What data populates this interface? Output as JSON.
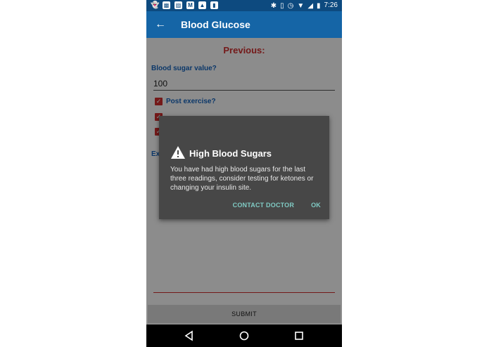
{
  "status_bar": {
    "time": "7:26",
    "left_icons": [
      "ghost-icon",
      "ticket-icon",
      "bag-icon",
      "gmail-icon",
      "image-icon",
      "sim-icon"
    ],
    "right_icons": [
      "bluetooth-icon",
      "vibrate-icon",
      "alarm-icon",
      "wifi-icon",
      "signal-icon",
      "battery-icon"
    ]
  },
  "app_bar": {
    "title": "Blood Glucose"
  },
  "form": {
    "heading": "Previous:",
    "value_label": "Blood sugar value?",
    "value": "100",
    "checkboxes": [
      {
        "label": "Post exercise?",
        "checked": true
      },
      {
        "label": "",
        "checked": true
      },
      {
        "label": "",
        "checked": true
      }
    ],
    "notes_label_partial": "Ex",
    "submit_label": "SUBMIT"
  },
  "dialog": {
    "title": "High Blood Sugars",
    "message": "You have had high blood sugars for the last three readings, consider testing for ketones or changing your insulin site.",
    "buttons": {
      "contact": "CONTACT DOCTOR",
      "ok": "OK"
    }
  },
  "colors": {
    "app_bar": "#1565a6",
    "status_bar": "#0d4a7f",
    "accent_red": "#d32f2f",
    "label_blue": "#1565c0",
    "dialog_bg": "#474747",
    "dialog_button": "#80cbc4"
  }
}
